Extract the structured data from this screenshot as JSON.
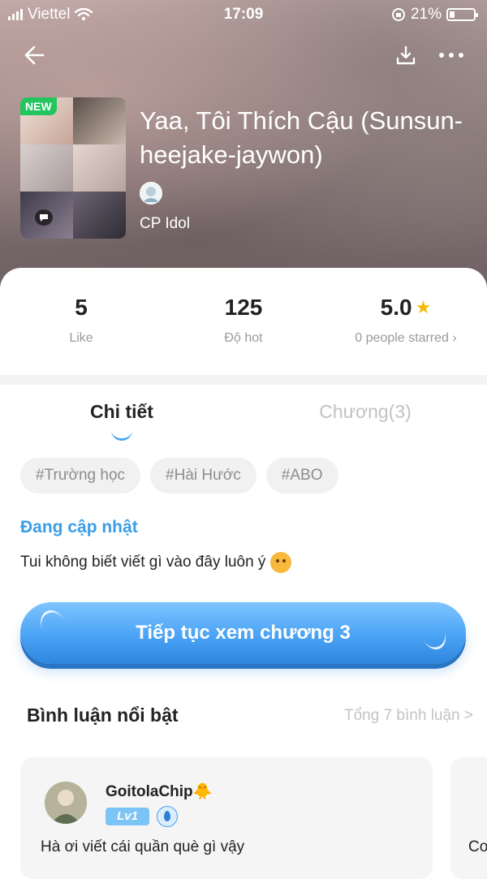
{
  "status_bar": {
    "carrier": "Viettel",
    "time": "17:09",
    "battery": "21%"
  },
  "header": {
    "new_badge": "NEW"
  },
  "story": {
    "title": "Yaa, Tôi Thích Cậu (Sunsun-heejake-jaywon)",
    "category": "CP Idol"
  },
  "stats": {
    "likes": {
      "value": "5",
      "label": "Like"
    },
    "hot": {
      "value": "125",
      "label": "Độ hot"
    },
    "rating": {
      "value": "5.0",
      "label": "0 people starred ›"
    }
  },
  "tabs": {
    "details": "Chi tiết",
    "chapters": "Chương(3)"
  },
  "tags": [
    "#Trường học",
    "#Hài Hước",
    "#ABO"
  ],
  "status_text": "Đang cập nhật",
  "description": "Tui không biết viết gì vào đây luôn ý",
  "continue_button": "Tiếp tục xem chương 3",
  "comments_section": {
    "title": "Bình luận nổi bật",
    "total_link": "Tổng 7 bình luận >",
    "comments": [
      {
        "user": "GoitolaChip🐥",
        "level": "Lv1",
        "text": "Hà ơi viết cái quần què gì vậy"
      },
      {
        "text": "Co"
      }
    ]
  },
  "colors": {
    "accent": "#3a9de6",
    "star": "#f5b90b",
    "new_badge": "#22c55e"
  }
}
